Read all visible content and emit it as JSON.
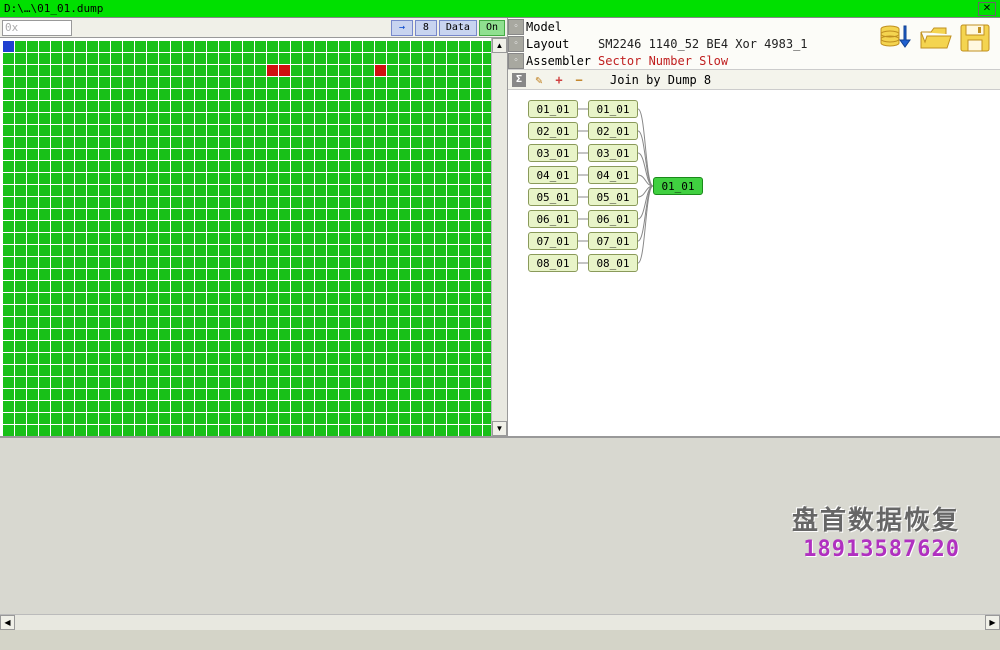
{
  "window": {
    "title": "D:\\…\\01_01.dump",
    "close": "✕"
  },
  "left_toolbar": {
    "addr_prefix": "0x",
    "arrow": "→",
    "number": "8",
    "data_label": "Data",
    "on_label": "On"
  },
  "grid": {
    "cols": 42,
    "rows": 34,
    "blue_cells": [
      [
        0,
        0
      ]
    ],
    "red_cells": [
      [
        2,
        22
      ],
      [
        2,
        23
      ],
      [
        2,
        31
      ]
    ]
  },
  "props": {
    "model_label": "Model",
    "model_value": "",
    "layout_label": "Layout",
    "layout_value": "SM2246 1140_52 BE4 Xor 4983_1",
    "assembler_label": "Assembler",
    "assembler_value": "Sector Number Slow"
  },
  "tree_toolbar": {
    "sigma": "Σ",
    "wand": "✎",
    "plus": "+",
    "minus": "−",
    "title": "Join by Dump 8"
  },
  "tree": {
    "col1": [
      "01_01",
      "02_01",
      "03_01",
      "04_01",
      "05_01",
      "06_01",
      "07_01",
      "08_01"
    ],
    "col2": [
      "01_01",
      "02_01",
      "03_01",
      "04_01",
      "05_01",
      "06_01",
      "07_01",
      "08_01"
    ],
    "merged": "01_01"
  },
  "icons": {
    "db_down": "db-arrow-down-icon",
    "folder": "folder-open-icon",
    "save": "save-disk-icon"
  },
  "watermark": {
    "text": "盘首数据恢复",
    "phone": "18913587620"
  },
  "scroll": {
    "up": "▲",
    "down": "▼",
    "left": "◀",
    "right": "▶"
  }
}
